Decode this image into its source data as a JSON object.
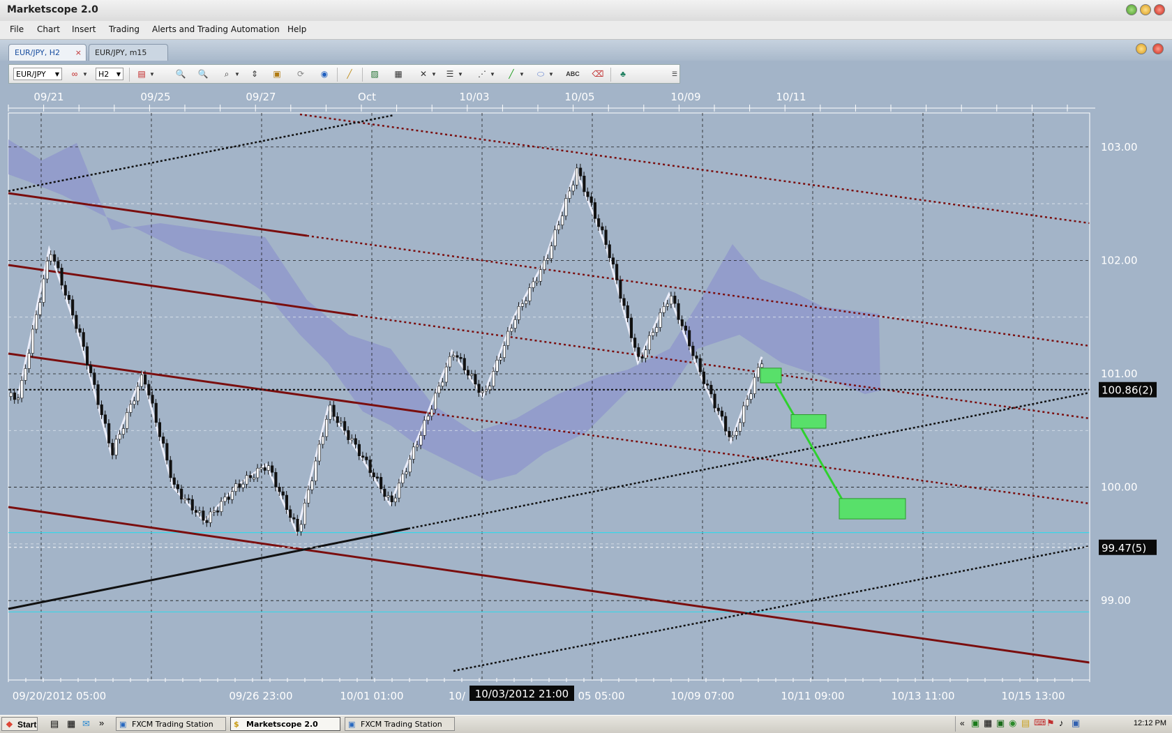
{
  "window": {
    "title": "Marketscope 2.0"
  },
  "menu": [
    "File",
    "Chart",
    "Insert",
    "Trading",
    "Alerts and Trading Automation",
    "Help"
  ],
  "tabs": [
    {
      "label": "EUR/JPY, H2",
      "active": true,
      "close": "×"
    },
    {
      "label": "EUR/JPY, m15",
      "active": false
    }
  ],
  "toolbar": {
    "symbol": "EUR/JPY",
    "timeframe": "H2",
    "text_tool_label": "ABC"
  },
  "chart_data": {
    "type": "line",
    "instrument": "EUR/JPY",
    "timeframe": "H2",
    "top_dates": [
      "09/21",
      "09/25",
      "09/27",
      "Oct",
      "10/03",
      "10/05",
      "10/09",
      "10/11"
    ],
    "bottom_dates": [
      "09/20/2012 05:00",
      "09/26 23:00",
      "10/01 01:00",
      "10/",
      "10/03/2012 21:00",
      "05 05:00",
      "10/09 07:00",
      "10/11 09:00",
      "10/13 11:00",
      "10/15 13:00"
    ],
    "y_ticks": [
      "103.00",
      "102.00",
      "101.00",
      "100.00",
      "99.00"
    ],
    "ylim": [
      98.3,
      103.3
    ],
    "current_price_label": "100.86(2)",
    "current_price": 100.86,
    "level_label": "99.47(5)",
    "level": 99.47,
    "cursor_label": "10/03/2012 21:00",
    "zigzag_prices": [
      100.8,
      102.1,
      101.3,
      100.3,
      101.0,
      100.0,
      99.7,
      100.0,
      100.2,
      99.6,
      100.7,
      100.3,
      99.85,
      100.5,
      101.2,
      100.8,
      101.5,
      102.0,
      102.8,
      102.1,
      101.1,
      101.7,
      101.0,
      100.4,
      101.15
    ],
    "projection_prices": [
      100.95,
      99.8
    ],
    "target_zones": [
      {
        "low": 100.92,
        "high": 101.05
      },
      {
        "low": 100.52,
        "high": 100.64
      },
      {
        "low": 99.72,
        "high": 99.9
      }
    ]
  },
  "taskbar": {
    "start": "Start",
    "tasks": [
      {
        "label": "FXCM Trading Station",
        "active": false
      },
      {
        "label": "Marketscope 2.0",
        "active": true
      },
      {
        "label": "FXCM Trading Station",
        "active": false
      }
    ],
    "clock": "12:12 PM"
  },
  "colors": {
    "chart_bg": "#a3b4c8",
    "cloud": "#8b93cc",
    "channel": "#7a0e0e",
    "zone": "#58e06a",
    "projection": "#2ed12e"
  }
}
